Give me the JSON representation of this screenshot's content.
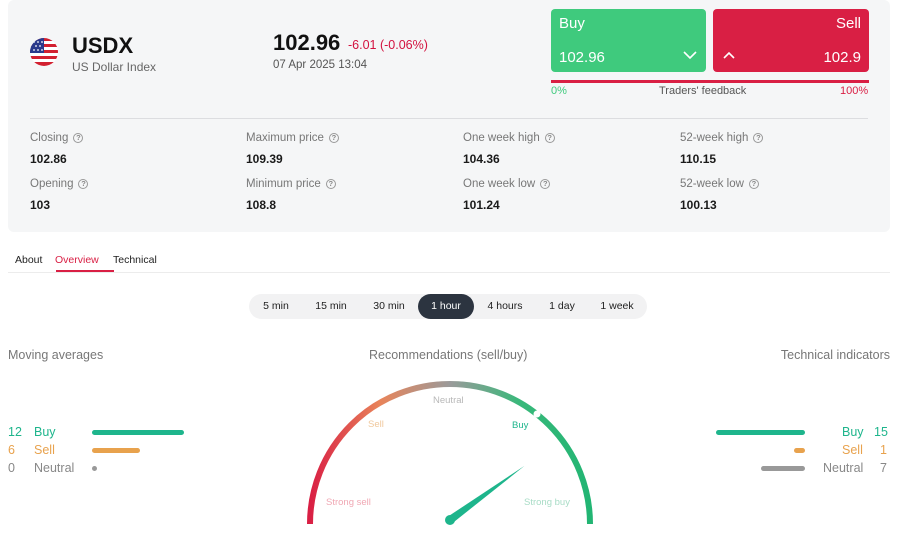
{
  "instrument": {
    "symbol": "USDX",
    "name": "US Dollar Index",
    "flag_icon": "us-flag-icon",
    "price": "102.96",
    "change": "-6.01 (-0.06%)",
    "timestamp": "07 Apr 2025 13:04"
  },
  "trade": {
    "buy_label": "Buy",
    "buy_price": "102.96",
    "sell_label": "Sell",
    "sell_price": "102.9",
    "feedback_left": "0%",
    "feedback_label": "Traders' feedback",
    "feedback_right": "100%",
    "buy_color": "#3fca7d",
    "sell_color": "#d91f44"
  },
  "stats": {
    "closing_label": "Closing",
    "closing": "102.86",
    "max_label": "Maximum price",
    "max": "109.39",
    "week_high_label": "One week high",
    "week_high": "104.36",
    "year_high_label": "52-week high",
    "year_high": "110.15",
    "opening_label": "Opening",
    "opening": "103",
    "min_label": "Minimum price",
    "min": "108.8",
    "week_low_label": "One week low",
    "week_low": "101.24",
    "year_low_label": "52-week low",
    "year_low": "100.13"
  },
  "tabs": [
    {
      "label": "About"
    },
    {
      "label": "Overview",
      "active": true
    },
    {
      "label": "Technical"
    }
  ],
  "timeframes": [
    {
      "label": "5 min"
    },
    {
      "label": "15 min"
    },
    {
      "label": "30 min"
    },
    {
      "label": "1 hour",
      "active": true
    },
    {
      "label": "4 hours"
    },
    {
      "label": "1 day"
    },
    {
      "label": "1 week"
    }
  ],
  "moving_averages": {
    "title": "Moving averages",
    "buy_count": "12",
    "buy_label": "Buy",
    "sell_count": "6",
    "sell_label": "Sell",
    "neutral_count": "0",
    "neutral_label": "Neutral"
  },
  "recommendations": {
    "title": "Recommendations (sell/buy)",
    "strong_sell": "Strong sell",
    "sell": "Sell",
    "neutral": "Neutral",
    "buy": "Buy",
    "strong_buy": "Strong buy",
    "needle_fraction": 0.8
  },
  "technical_indicators": {
    "title": "Technical indicators",
    "buy_count": "15",
    "buy_label": "Buy",
    "sell_count": "1",
    "sell_label": "Sell",
    "neutral_count": "7",
    "neutral_label": "Neutral"
  },
  "colors": {
    "buy": "#1eb58c",
    "sell": "#e8a24d",
    "neutral": "#999999",
    "accent": "#d91f44",
    "active_timeframe": "#2c3440"
  }
}
